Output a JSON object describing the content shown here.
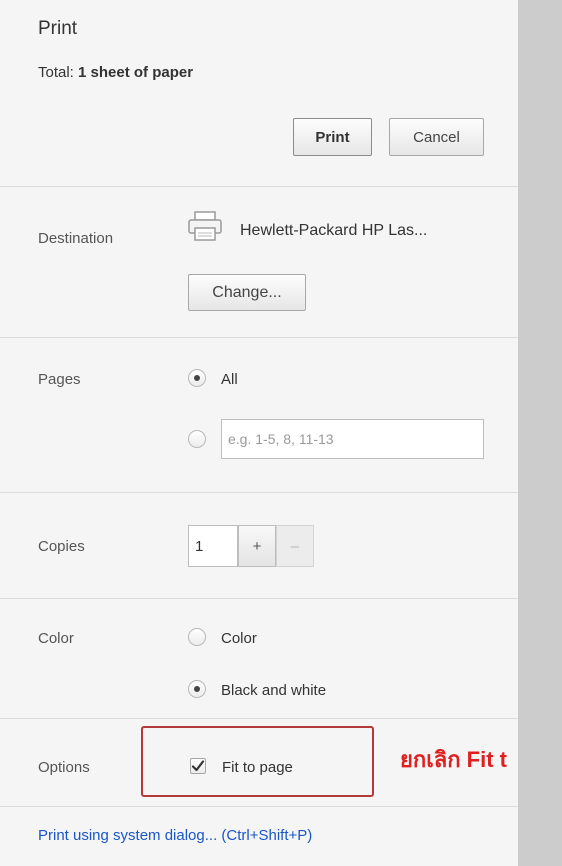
{
  "header": {
    "title": "Print",
    "total_label": "Total:",
    "total_value": "1 sheet of paper",
    "print_button": "Print",
    "cancel_button": "Cancel"
  },
  "destination": {
    "label": "Destination",
    "printer_name": "Hewlett-Packard HP Las...",
    "change_button": "Change...",
    "icon": "printer-icon"
  },
  "pages": {
    "label": "Pages",
    "options": [
      {
        "label": "All",
        "selected": true
      },
      {
        "label": "",
        "selected": false
      }
    ],
    "custom_placeholder": "e.g. 1-5, 8, 11-13"
  },
  "copies": {
    "label": "Copies",
    "value": "1",
    "increment": "+",
    "decrement": "–"
  },
  "color": {
    "label": "Color",
    "options": [
      {
        "label": "Color",
        "selected": false
      },
      {
        "label": "Black and white",
        "selected": true
      }
    ]
  },
  "options": {
    "label": "Options",
    "fit_to_page": {
      "label": "Fit to page",
      "checked": true
    }
  },
  "annotation": {
    "text": "ยกเลิก Fit t",
    "color": "#e02020",
    "box_color": "#b23a3a"
  },
  "footer": {
    "system_dialog_link": "Print using system dialog... (Ctrl+Shift+P)"
  },
  "colors": {
    "panel_bg": "#f5f5f5",
    "scroll_gutter": "#cccccc",
    "link": "#1a56c8"
  }
}
